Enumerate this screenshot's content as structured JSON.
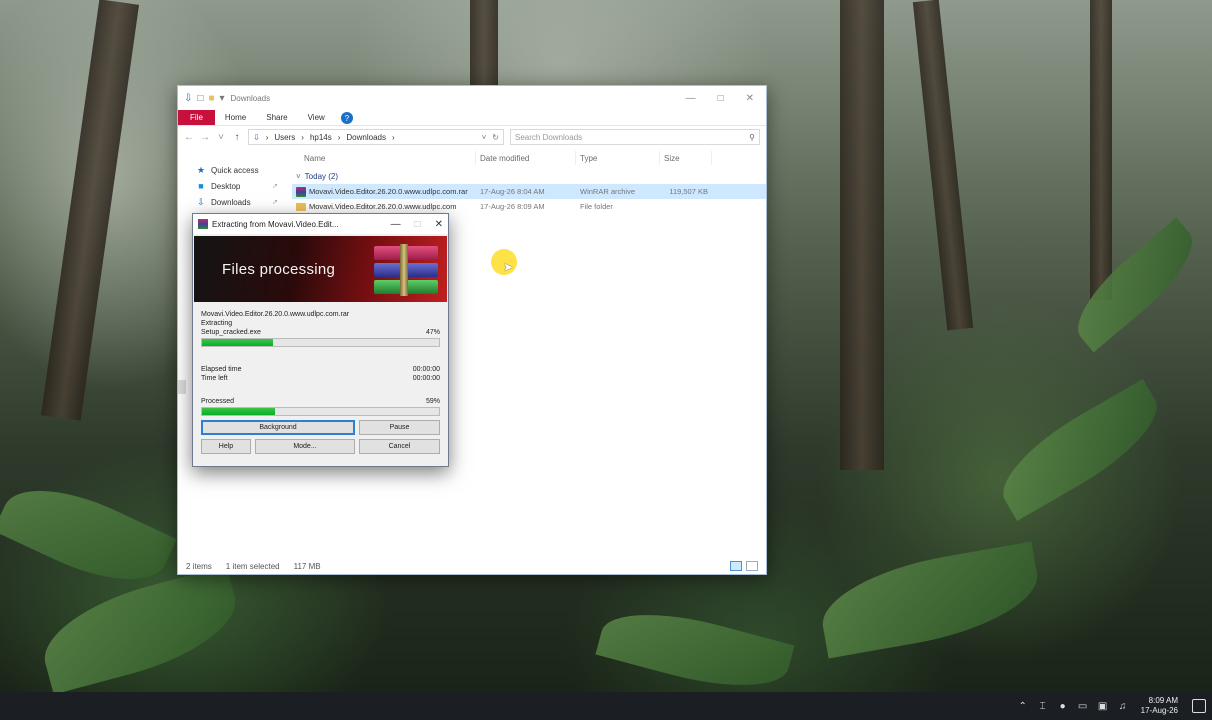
{
  "explorer": {
    "title": "Downloads",
    "ribbon_tabs": [
      "File",
      "Home",
      "Share",
      "View"
    ],
    "address_path": [
      "Users",
      "hp14s",
      "Downloads"
    ],
    "search_placeholder": "Search Downloads",
    "nav": [
      {
        "label": "Quick access",
        "icon": "star-icon"
      },
      {
        "label": "Desktop",
        "icon": "desktop-icon"
      },
      {
        "label": "Downloads",
        "icon": "download-icon"
      }
    ],
    "columns": [
      "Name",
      "Date modified",
      "Type",
      "Size"
    ],
    "group": "Today (2)",
    "files": [
      {
        "name": "Movavi.Video.Editor.26.20.0.www.udlpc.com.rar",
        "date": "17-Aug-26 8:04 AM",
        "type": "WinRAR archive",
        "size": "119,507 KB",
        "selected": true
      },
      {
        "name": "Movavi.Video.Editor.26.20.0.www.udlpc.com",
        "date": "17-Aug-26 8:09 AM",
        "type": "File folder",
        "size": "",
        "selected": false
      }
    ],
    "status": {
      "items": "2 items",
      "selection": "1 item selected",
      "size": "117 MB"
    }
  },
  "rar": {
    "title": "Extracting from Movavi.Video.Edit...",
    "banner_text": "Files processing",
    "archive": "Movavi.Video.Editor.26.20.0.www.udlpc.com.rar",
    "action": "Extracting",
    "current_file": "Setup_cracked.exe",
    "file_percent": "47%",
    "file_progress": 0.3,
    "elapsed_label": "Elapsed time",
    "elapsed_value": "00:00:00",
    "timeleft_label": "Time left",
    "timeleft_value": "00:00:00",
    "processed_label": "Processed",
    "processed_percent": "59%",
    "processed_progress": 0.31,
    "buttons": {
      "background": "Background",
      "pause": "Pause",
      "help": "Help",
      "mode": "Mode...",
      "cancel": "Cancel"
    }
  },
  "taskbar": {
    "time": "8:09 AM",
    "date": "17-Aug-26"
  },
  "colors": {
    "file_tab": "#c8103c",
    "progress": "#06b025",
    "selection": "#cde8ff",
    "taskbar": "#1b1e23",
    "cursor_highlight": "#ffdc28"
  }
}
